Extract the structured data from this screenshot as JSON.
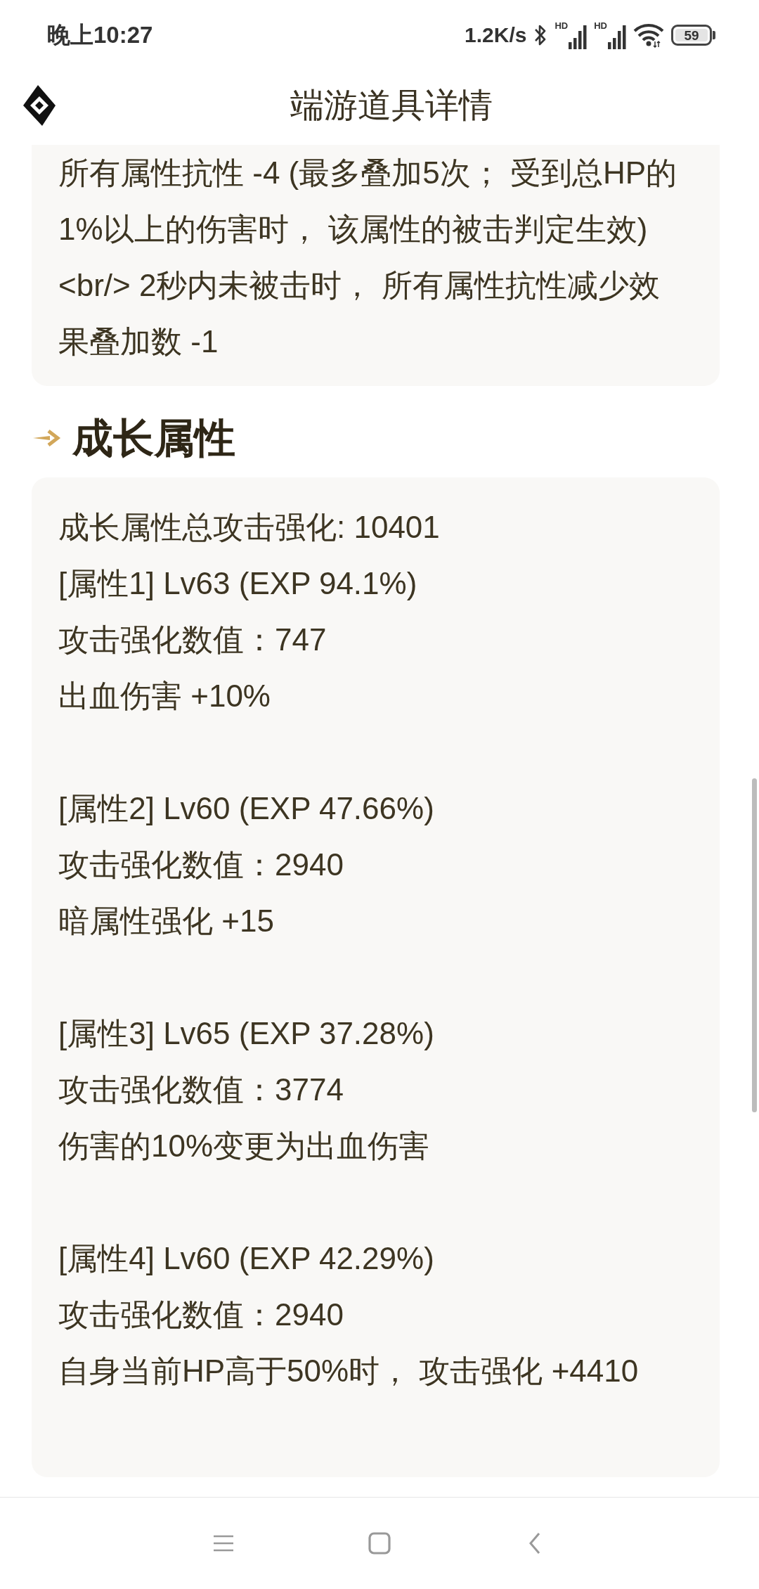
{
  "status_bar": {
    "time": "晚上10:27",
    "network_speed": "1.2K/s",
    "sim_labels": [
      "HD",
      "HD"
    ],
    "battery": "59"
  },
  "header": {
    "title": "端游道具详情"
  },
  "effect_card": {
    "text": "所有属性抗性 -4 (最多叠加5次； 受到总HP的1%以上的伤害时， 该属性的被击判定生效) <br/> 2秒内未被击时， 所有属性抗性减少效果叠加数 -1"
  },
  "growth_section": {
    "title": "成长属性",
    "total": "成长属性总攻击强化: 10401",
    "attributes": [
      {
        "lines": [
          "[属性1] Lv63 (EXP 94.1%)",
          "攻击强化数值：747",
          "出血伤害 +10%"
        ]
      },
      {
        "lines": [
          "[属性2] Lv60 (EXP 47.66%)",
          "攻击强化数值：2940",
          "暗属性强化 +15"
        ]
      },
      {
        "lines": [
          "[属性3] Lv65 (EXP 37.28%)",
          "攻击强化数值：3774",
          "伤害的10%变更为出血伤害"
        ]
      },
      {
        "lines": [
          "[属性4] Lv60 (EXP 42.29%)",
          "攻击强化数值：2940",
          "自身当前HP高于50%时， 攻击强化 +4410"
        ]
      }
    ]
  }
}
